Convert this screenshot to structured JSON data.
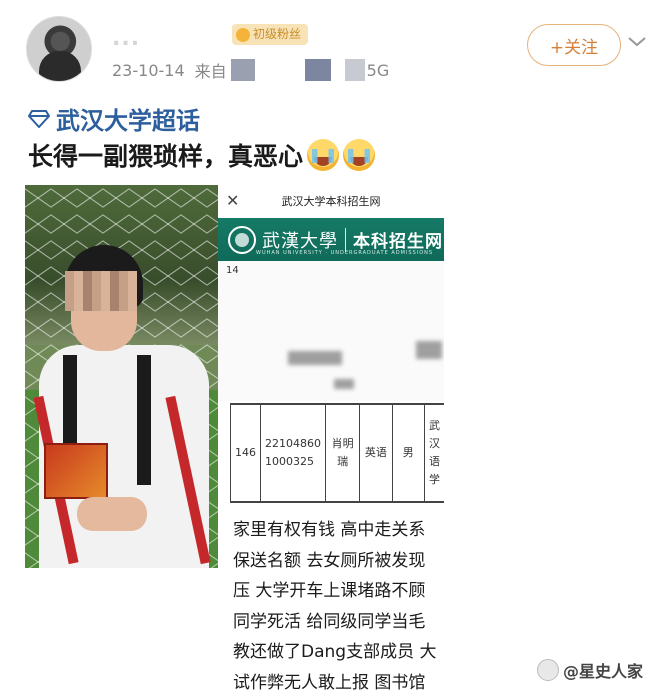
{
  "post": {
    "username": "...",
    "badge_label": "初级粉丝",
    "date": "23-10-14",
    "source_label": "来自",
    "source_tail": "5G",
    "follow_label": "+关注",
    "topic": "武汉大学超话",
    "text": "长得一副猥琐样，真恶心",
    "emojis": [
      "crying-emoji",
      "crying-emoji"
    ]
  },
  "document": {
    "title": "武汉大学本科招生网",
    "close": "✕",
    "banner_cursive": "武漢大學",
    "banner_title": "本科招生网",
    "banner_sub": "WUHAN UNIVERSITY · UNDERGRADUATE ADMISSIONS",
    "row_top_number": "14",
    "table_row": {
      "index": "146",
      "id": "22104860 1000325",
      "name": "肖明瑞",
      "subject": "英语",
      "gender": "男",
      "school": "武汉语学"
    },
    "body_lines": [
      "家里有权有钱 高中走关系",
      "保送名额 去女厕所被发现",
      "压 大学开车上课堵路不顾",
      "同学死活 给同级同学当毛",
      "教还做了Dang支部成员 大",
      "试作弊无人敢上报 图书馆"
    ]
  },
  "watermark": {
    "text": "@星史人家"
  },
  "colors": {
    "topic": "#2d5f9e",
    "follow": "#d5813a",
    "banner": "#157a66",
    "badge": "#f7e3b6"
  }
}
